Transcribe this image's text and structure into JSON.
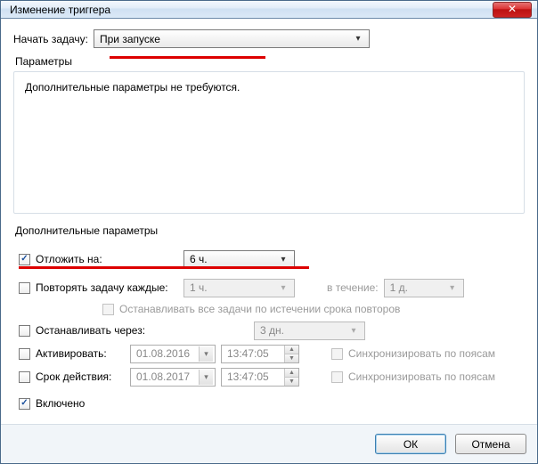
{
  "window": {
    "title": "Изменение триггера"
  },
  "begin": {
    "label": "Начать задачу:",
    "value": "При запуске"
  },
  "params": {
    "legend": "Параметры",
    "message": "Дополнительные параметры не требуются."
  },
  "advanced": {
    "legend": "Дополнительные параметры",
    "delay": {
      "checked": true,
      "label": "Отложить на:",
      "value": "6 ч."
    },
    "repeat": {
      "checked": false,
      "label": "Повторять задачу каждые:",
      "interval": "1 ч.",
      "for_label": "в течение:",
      "duration": "1 д.",
      "stop_all_label": "Останавливать все задачи по истечении срока повторов"
    },
    "stop_after": {
      "checked": false,
      "label": "Останавливать через:",
      "value": "3 дн."
    },
    "activate": {
      "checked": false,
      "label": "Активировать:",
      "date": "01.08.2016",
      "time": "13:47:05",
      "sync_label": "Синхронизировать по поясам"
    },
    "expire": {
      "checked": false,
      "label": "Срок действия:",
      "date": "01.08.2017",
      "time": "13:47:05",
      "sync_label": "Синхронизировать по поясам"
    },
    "enabled": {
      "checked": true,
      "label": "Включено"
    }
  },
  "buttons": {
    "ok": "ОК",
    "cancel": "Отмена"
  }
}
